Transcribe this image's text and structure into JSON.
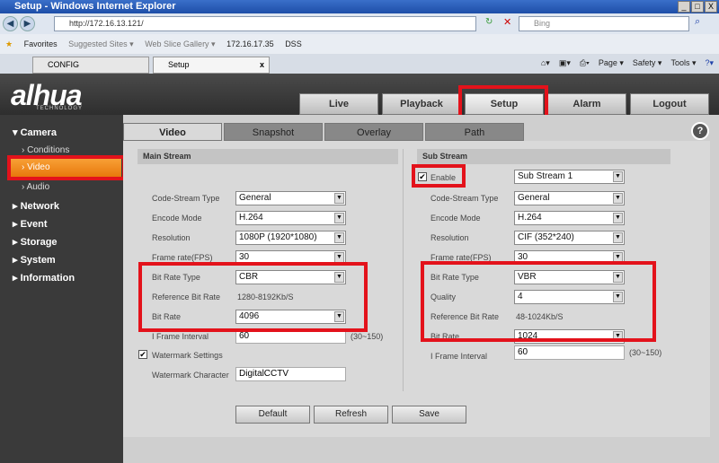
{
  "browser": {
    "title": "Setup - Windows Internet Explorer",
    "url": "http://172.16.13.121/",
    "search_placeholder": "Bing",
    "favorites": [
      "Favorites",
      "Suggested Sites ▾",
      "Web Slice Gallery ▾",
      "172.16.17.35",
      "DSS"
    ],
    "tabs": [
      "CONFIG",
      "Setup"
    ],
    "commands": [
      "Page ▾",
      "Safety ▾",
      "Tools ▾"
    ]
  },
  "logo": {
    "text": "alhua",
    "sub": "TECHNOLOGY"
  },
  "nav": [
    "Live",
    "Playback",
    "Setup",
    "Alarm",
    "Logout"
  ],
  "sidebar": {
    "camera": "Camera",
    "sub": [
      "Conditions",
      "Video",
      "Audio"
    ],
    "items": [
      "Network",
      "Event",
      "Storage",
      "System",
      "Information"
    ]
  },
  "tabs": [
    "Video",
    "Snapshot",
    "Overlay",
    "Path"
  ],
  "main": {
    "title": "Main Stream",
    "fields": [
      {
        "label": "Code-Stream Type",
        "value": "General"
      },
      {
        "label": "Encode Mode",
        "value": "H.264"
      },
      {
        "label": "Resolution",
        "value": "1080P (1920*1080)"
      },
      {
        "label": "Frame rate(FPS)",
        "value": "30"
      },
      {
        "label": "Bit Rate Type",
        "value": "CBR"
      },
      {
        "label": "Reference Bit Rate",
        "value": "1280-8192Kb/S"
      },
      {
        "label": "Bit Rate",
        "value": "4096"
      },
      {
        "label": "I Frame Interval",
        "value": "60"
      }
    ],
    "iframe_range": "(30~150)",
    "watermark": "Watermark Settings",
    "watermark_char_label": "Watermark Character",
    "watermark_char": "DigitalCCTV"
  },
  "sub": {
    "title": "Sub Stream",
    "enable": "Enable",
    "stream": "Sub Stream 1",
    "fields": [
      {
        "label": "Code-Stream Type",
        "value": "General"
      },
      {
        "label": "Encode Mode",
        "value": "H.264"
      },
      {
        "label": "Resolution",
        "value": "CIF (352*240)"
      },
      {
        "label": "Frame rate(FPS)",
        "value": "30"
      },
      {
        "label": "Bit Rate Type",
        "value": "VBR"
      },
      {
        "label": "Quality",
        "value": "4"
      },
      {
        "label": "Reference Bit Rate",
        "value": "48-1024Kb/S"
      },
      {
        "label": "Bit Rate",
        "value": "1024"
      },
      {
        "label": "I Frame Interval",
        "value": "60"
      }
    ],
    "iframe_range": "(30~150)"
  },
  "buttons": [
    "Default",
    "Refresh",
    "Save"
  ]
}
